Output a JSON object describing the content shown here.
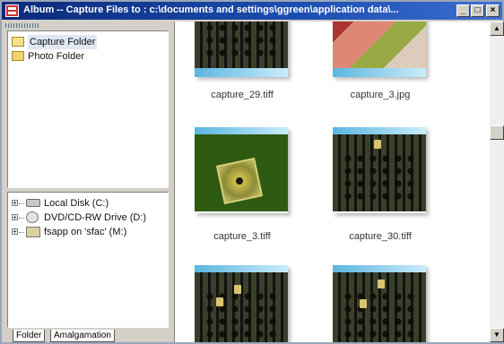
{
  "window": {
    "title": "Album -- Capture Files to : c:\\documents and settings\\ggreen\\application data\\...",
    "buttons": {
      "minimize": "_",
      "maximize": "□",
      "close": "×"
    }
  },
  "folder_pane": {
    "items": [
      {
        "label": "Capture Folder",
        "icon": "open-folder-icon",
        "selected": true
      },
      {
        "label": "Photo Folder",
        "icon": "folder-icon",
        "selected": false
      }
    ]
  },
  "drive_pane": {
    "items": [
      {
        "label": "Local Disk (C:)",
        "icon": "hard-drive-icon"
      },
      {
        "label": "DVD/CD-RW Drive (D:)",
        "icon": "cd-drive-icon"
      },
      {
        "label": "fsapp on 'sfac' (M:)",
        "icon": "network-drive-icon"
      }
    ]
  },
  "tabs": [
    "Folder",
    "Amalgamation"
  ],
  "thumbnails": [
    {
      "filename": "capture_29.tiff"
    },
    {
      "filename": "capture_3.jpg"
    },
    {
      "filename": "capture_3.tiff"
    },
    {
      "filename": "capture_30.tiff"
    },
    {
      "filename": ""
    },
    {
      "filename": ""
    }
  ],
  "scrollbar": {
    "up_arrow": "▲",
    "down_arrow": "▼"
  }
}
